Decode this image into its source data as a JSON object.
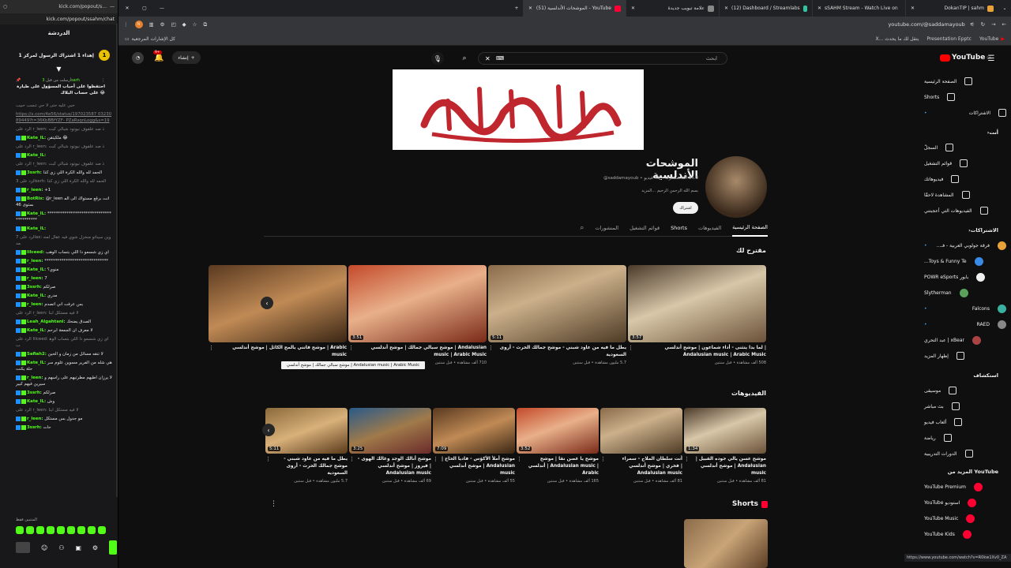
{
  "chat": {
    "window_url": "kick.com/popout/ssahm/chat",
    "window_url_short": "kick.com/popout/s...",
    "title": "الدردشة",
    "pinned_title": "إهداء 1 اشتراك الرسول لمركز 1",
    "pinned_count": "1",
    "pinned_by_user": "3sarh",
    "pinned_by": "أرسلت من قبل",
    "pinned_message": "احتفظوا على أحباب المسؤول على طيارة 😂 على حساب البلاك",
    "messages": [
      {
        "user": "",
        "text": "حبي عليه حتى لا حي تنسب حبيب"
      },
      {
        "user": "",
        "text": "https://x.com/4e56/status/197023587 0323089449?t=36KbBBfYZF- PZaRsqnLogg&s=19",
        "link": true
      },
      {
        "user": "",
        "text": "الرد على r_leen: ذ صد علفوف نيوتود شبالي كبت"
      },
      {
        "user": "Kate_lL:",
        "text": "ملكيتقن 😂"
      },
      {
        "user": "",
        "text": "الرد على r_leen: ذ صد علفوف نيوتود شبالي كبت"
      },
      {
        "user": "Kate_lL:",
        "text": ""
      },
      {
        "user": "",
        "text": "الرد على r_leen: ذ صد علفوف نيوتود شبالي كبت"
      },
      {
        "user": "3ssrh:",
        "text": "الحمد لله والله الكرة اللي زي كذا"
      },
      {
        "user": "",
        "text": "الرد على 3ssrh: الحمد لله والله الكرة اللي زي كذا"
      },
      {
        "user": "r_leen:",
        "text": "+1"
      },
      {
        "user": "BotRix:",
        "text": "@r_leen انت برقع مستواك الى المستوى 46"
      },
      {
        "user": "Kate_lL:",
        "text": "****************************************"
      },
      {
        "user": "Kate_lL:",
        "text": ""
      },
      {
        "user": "",
        "text": "الرد على 7ax: وين سيناتو منخزل شوي فيه عقال لمحمد"
      },
      {
        "user": "lilceed:",
        "text": "اي زي شسمو دا اللي بتساب الوهب"
      },
      {
        "user": "r_leen:",
        "text": "******************************"
      },
      {
        "user": "Kate_lL:",
        "text": "منوي؟"
      },
      {
        "user": "r_leen:",
        "text": "7"
      },
      {
        "user": "3ssrh:",
        "text": "صرلكم"
      },
      {
        "user": "Kate_lL:",
        "text": "مدري"
      },
      {
        "user": "r_leen:",
        "text": "بس عرفت اني اتصدم"
      },
      {
        "user": "",
        "text": "الرد على r_leen: لا فيه مستكل ابنا"
      },
      {
        "user": "Leah_Algahtani:",
        "text": "الصدق يضحك"
      },
      {
        "user": "Kate_lL:",
        "text": "لا معرف ان الجمعة ابرحم"
      },
      {
        "user": "",
        "text": "الرد على lilceed: اي زي شسمو دا اللي بتساب الوهب"
      },
      {
        "user": "Safiah2:",
        "text": "لا تنقه مسائل من زمان و الحين"
      },
      {
        "user": "Kate_lL:",
        "text": "هي شله من الفرير مسوين علوم سرحلة يكنت"
      },
      {
        "user": "r_leen:",
        "text": "لا يرزان اطيهم مطرتيهم على راسهم وسيرين فيهم كبير"
      },
      {
        "user": "3ssrh:",
        "text": "صرلكم"
      },
      {
        "user": "Kate_lL:",
        "text": "وش"
      },
      {
        "user": "",
        "text": "الرد على r_leen: لا فيه مستكل ابنا"
      },
      {
        "user": "r_leen:",
        "text": "مو جدول بس مستكل"
      },
      {
        "user": "3ssrh:",
        "text": "حات"
      }
    ],
    "emote_label": "المتنبين فقط"
  },
  "browser": {
    "tabs": [
      {
        "label": "DokanTIP | sahm",
        "color": "#e8a23a"
      },
      {
        "label": "sSAHM Stream - Watch Live on",
        "color": "#53fc18"
      },
      {
        "label": "(12) Dashboard / Streamlabs",
        "color": "#31c3a2"
      },
      {
        "label": "علامة تبويب جديدة",
        "color": "#888"
      },
      {
        "label": "(51) الموشحات الأندلسية - YouTube",
        "color": "#ff0033"
      }
    ],
    "url": "youtube.com/@saddamayoub",
    "bookmarks_right": [
      "YouTube",
      "Presentation Epptc",
      "X... يتقل لك ما يحدث"
    ],
    "bookmarks_left": "كل الإشارات المرجعية"
  },
  "youtube": {
    "logo": "YouTube",
    "country": "SA",
    "search_placeholder": "ابحث",
    "create_label": "إنشاء",
    "notif_count": "9+",
    "sidebar": {
      "main": [
        "الصفحة الرئيسية",
        "Shorts",
        "الاشتراكات"
      ],
      "you_title": "أنت",
      "you": [
        "السجلّ",
        "قوائم التشغيل",
        "فيديوهاتك",
        "المشاهدة لاحقًا",
        "الفيديوهات التي أعجبتني"
      ],
      "subs_title": "الاشتراكات",
      "subs": [
        "فرقة جولوبي العربية - فـ...",
        "Toys & Funny Te...",
        "بابور POWR eSports",
        "Slytherman",
        "Falcons",
        "RAED",
        "xBear | عبد التحري",
        "إظهار المزيد"
      ],
      "explore_title": "استكشاف",
      "explore": [
        "موسيقى",
        "بث مباشر",
        "ألعاب فيديو",
        "رياضة",
        "الدورات التدريبية"
      ],
      "more_title": "المزيد من YouTube",
      "more": [
        "YouTube Premium",
        "استوديو YouTube",
        "YouTube Music",
        "YouTube Kids"
      ]
    },
    "banner_text": "ولا غالب إلا الله",
    "channel": {
      "name": "الموشحات الأندلسية",
      "handle": "@saddamayoub",
      "meta": "@saddamayoub • ‏94.8 ألف مشترك • ‏45 فيديو",
      "description": "بسم الله الرحمن الرحيم ...المزيد",
      "subscribe": "اشتراك"
    },
    "tabs": [
      "الصفحة الرئيسية",
      "الفيديوهات",
      "Shorts",
      "قوائم التشغيل",
      "المنشورات"
    ],
    "for_you_title": "مقترح لك",
    "for_you": [
      {
        "title": "لما بدا يتثنى - أداء شماعون | موشح أندلسي | Andalusian music | Arabic Music",
        "meta": "‏508 ألف مشاهدة • قبل سنتين",
        "duration": "3:57"
      },
      {
        "title": "يطل ما فيه من عاود شبني - موشح جمالك الحرث - أروى السعودية",
        "meta": "‏5.7 مليون مشاهدة • قبل سنتين",
        "duration": "5:11"
      },
      {
        "title": "موشح سبالي جمالك | موشح أندلسي | Andalusian music | Arabic Music",
        "meta": "‏710 ألف مشاهدة • قبل سنتين",
        "duration": "3:51"
      },
      {
        "title": "موشح فاتني يالمح الكائل | موشح أندلسي | Arabic music",
        "meta": "",
        "duration": ""
      }
    ],
    "tooltip": "موشح سبالي جمالك | موشح أندلسي | Andalusian music | Arabic Music",
    "videos_title": "الفيديوهات",
    "videos": [
      {
        "title": "موشح عسن يالي جوده القبيل | موشح أندلسي | Andalusian music",
        "meta": "‏81 ألف مشاهدة • قبل سنتين",
        "duration": "1:34"
      },
      {
        "title": "أنت سلطان الملاح - سمراء فخري | موشح أندلسي | Andalusian music",
        "meta": "‏81 ألف مشاهدة • قبل سنتين",
        "duration": ""
      },
      {
        "title": "موشح يا غصن نقا | موشح أندلسي | Andalusian music | Arabic",
        "meta": "‏165 ألف مشاهدة • قبل سنتين",
        "duration": "3:52"
      },
      {
        "title": "موشح أملأ الأكؤس - فاديا الحاج | موشح أندلسي | Andalusian music",
        "meta": "‏55 ألف مشاهدة • قبل سنتين",
        "duration": "7:09"
      },
      {
        "title": "موشح أنالك الوجد وغالك الهوى - فيروز | موشح أندلسي | Andalusian music",
        "meta": "‏69 ألف مشاهدة • قبل سنتين",
        "duration": "3:25"
      },
      {
        "title": "يطل ما فيه من عاود شبني - موشح جمالك الحرث - أروى السعودية",
        "meta": "‏5.7 مليون مشاهدة • قبل سنتين",
        "duration": "5:11"
      }
    ],
    "shorts_title": "Shorts",
    "status_url": "https://www.youtube.com/watch?v=R0kw1Xv0_ZA"
  }
}
